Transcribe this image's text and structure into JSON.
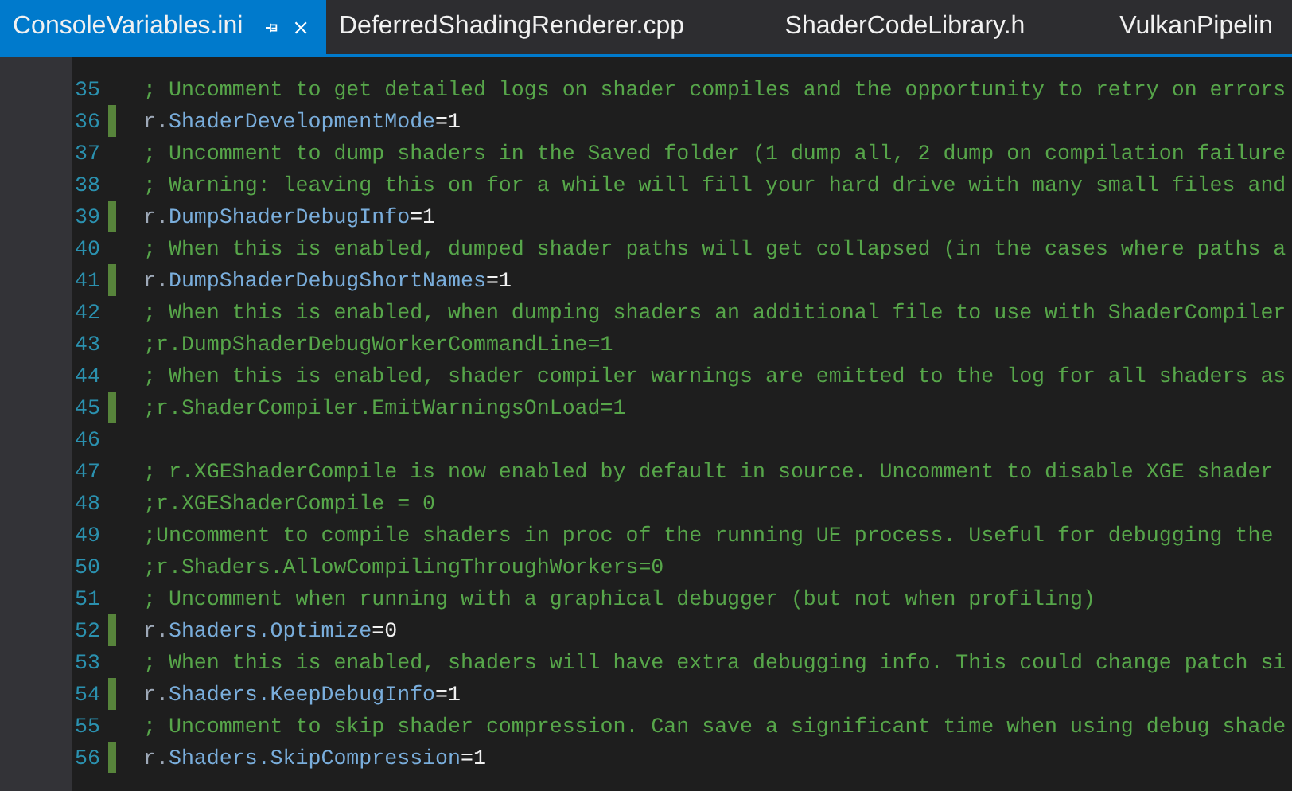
{
  "tabs": [
    {
      "label": "ConsoleVariables.ini",
      "selected": true,
      "pinned": true
    },
    {
      "label": "DeferredShadingRenderer.cpp",
      "selected": false,
      "pinned": false
    },
    {
      "label": "ShaderCodeLibrary.h",
      "selected": false,
      "pinned": false
    },
    {
      "label": "VulkanPipelin",
      "selected": false,
      "pinned": false
    }
  ],
  "lines": [
    {
      "number": "35",
      "kind": "comment",
      "text": "; Uncomment to get detailed logs on shader compiles and the opportunity to retry on errors",
      "changed": false
    },
    {
      "number": "36",
      "kind": "setting",
      "prefix": "r.",
      "key": "ShaderDevelopmentMode",
      "value": "=1",
      "changed": true
    },
    {
      "number": "37",
      "kind": "comment",
      "text": "; Uncomment to dump shaders in the Saved folder (1 dump all, 2 dump on compilation failure",
      "changed": false
    },
    {
      "number": "38",
      "kind": "comment",
      "text": "; Warning: leaving this on for a while will fill your hard drive with many small files and",
      "changed": false
    },
    {
      "number": "39",
      "kind": "setting",
      "prefix": "r.",
      "key": "DumpShaderDebugInfo",
      "value": "=1",
      "changed": true
    },
    {
      "number": "40",
      "kind": "comment",
      "text": "; When this is enabled, dumped shader paths will get collapsed (in the cases where paths a",
      "changed": false
    },
    {
      "number": "41",
      "kind": "setting",
      "prefix": "r.",
      "key": "DumpShaderDebugShortNames",
      "value": "=1",
      "changed": true
    },
    {
      "number": "42",
      "kind": "comment",
      "text": "; When this is enabled, when dumping shaders an additional file to use with ShaderCompiler",
      "changed": false
    },
    {
      "number": "43",
      "kind": "comment",
      "text": ";r.DumpShaderDebugWorkerCommandLine=1",
      "changed": false
    },
    {
      "number": "44",
      "kind": "comment",
      "text": "; When this is enabled, shader compiler warnings are emitted to the log for all shaders as",
      "changed": false
    },
    {
      "number": "45",
      "kind": "comment",
      "text": ";r.ShaderCompiler.EmitWarningsOnLoad=1",
      "changed": true
    },
    {
      "number": "46",
      "kind": "blank",
      "changed": false
    },
    {
      "number": "47",
      "kind": "comment",
      "text": "; r.XGEShaderCompile is now enabled by default in source. Uncomment to disable XGE shader",
      "changed": false
    },
    {
      "number": "48",
      "kind": "comment",
      "text": ";r.XGEShaderCompile = 0",
      "changed": false
    },
    {
      "number": "49",
      "kind": "comment",
      "text": ";Uncomment to compile shaders in proc of the running UE process. Useful for debugging the",
      "changed": false
    },
    {
      "number": "50",
      "kind": "comment",
      "text": ";r.Shaders.AllowCompilingThroughWorkers=0",
      "changed": false
    },
    {
      "number": "51",
      "kind": "comment",
      "text": "; Uncomment when running with a graphical debugger (but not when profiling)",
      "changed": false
    },
    {
      "number": "52",
      "kind": "setting",
      "prefix": "r.",
      "key": "Shaders.Optimize",
      "value": "=0",
      "changed": true
    },
    {
      "number": "53",
      "kind": "comment",
      "text": "; When this is enabled, shaders will have extra debugging info. This could change patch si",
      "changed": false
    },
    {
      "number": "54",
      "kind": "setting",
      "prefix": "r.",
      "key": "Shaders.KeepDebugInfo",
      "value": "=1",
      "changed": true
    },
    {
      "number": "55",
      "kind": "comment",
      "text": "; Uncomment to skip shader compression. Can save a significant time when using debug shade",
      "changed": false
    },
    {
      "number": "56",
      "kind": "setting",
      "prefix": "r.",
      "key": "Shaders.SkipCompression",
      "value": "=1",
      "changed": true
    }
  ]
}
